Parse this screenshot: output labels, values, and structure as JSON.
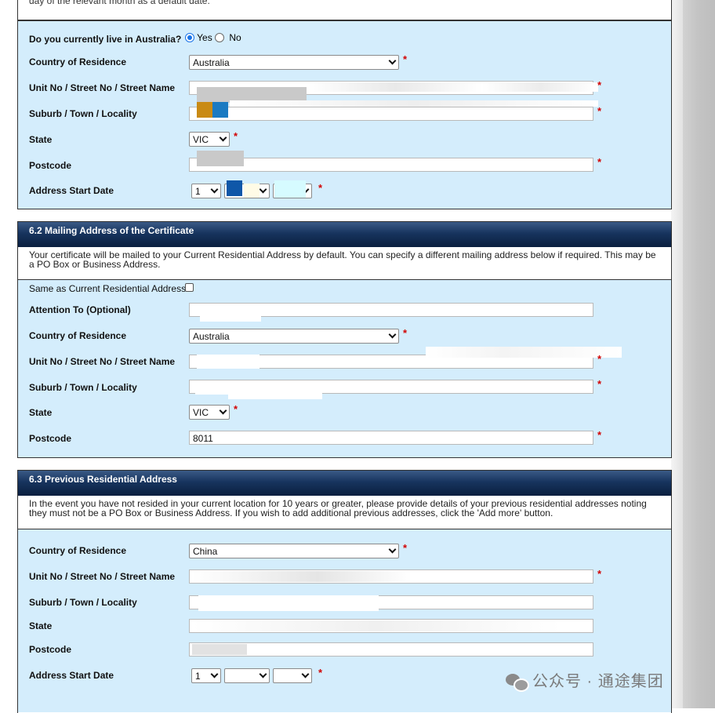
{
  "top_note": "day of the relevant month as a default date.",
  "residential": {
    "live_in_australia_label": "Do you currently live in Australia?",
    "yes_label": "Yes",
    "no_label": "No",
    "country_label": "Country of Residence",
    "country_value": "Australia",
    "street_label": "Unit No / Street No / Street Name",
    "suburb_label": "Suburb / Town / Locality",
    "state_label": "State",
    "state_value": "VIC",
    "postcode_label": "Postcode",
    "start_date_label": "Address Start Date",
    "start_day_value": "1"
  },
  "mailing": {
    "title": "6.2 Mailing Address of the Certificate",
    "intro": "Your certificate will be mailed to your Current Residential Address by default. You can specify a different mailing address below if required. This may be a PO Box or Business Address.",
    "same_as_label": "Same as Current Residential Address",
    "attention_label": "Attention To (Optional)",
    "country_label": "Country of Residence",
    "country_value": "Australia",
    "street_label": "Unit No / Street No / Street Name",
    "suburb_label": "Suburb / Town / Locality",
    "state_label": "State",
    "state_value": "VIC",
    "postcode_label": "Postcode",
    "postcode_value": "8011"
  },
  "previous": {
    "title": "6.3 Previous Residential Address",
    "intro": "In the event you have not resided in your current location for 10 years or greater, please provide details of your previous residential addresses noting they must not be a PO Box or Business Address. If you wish to add additional previous addresses, click the 'Add more' button.",
    "country_label": "Country of Residence",
    "country_value": "China",
    "street_label": "Unit No / Street No / Street Name",
    "suburb_label": "Suburb / Town / Locality",
    "state_label": "State",
    "postcode_label": "Postcode",
    "start_date_label": "Address Start Date",
    "start_day_value": "1"
  },
  "required_mark": "*",
  "watermark": "公众号 · 通途集团"
}
